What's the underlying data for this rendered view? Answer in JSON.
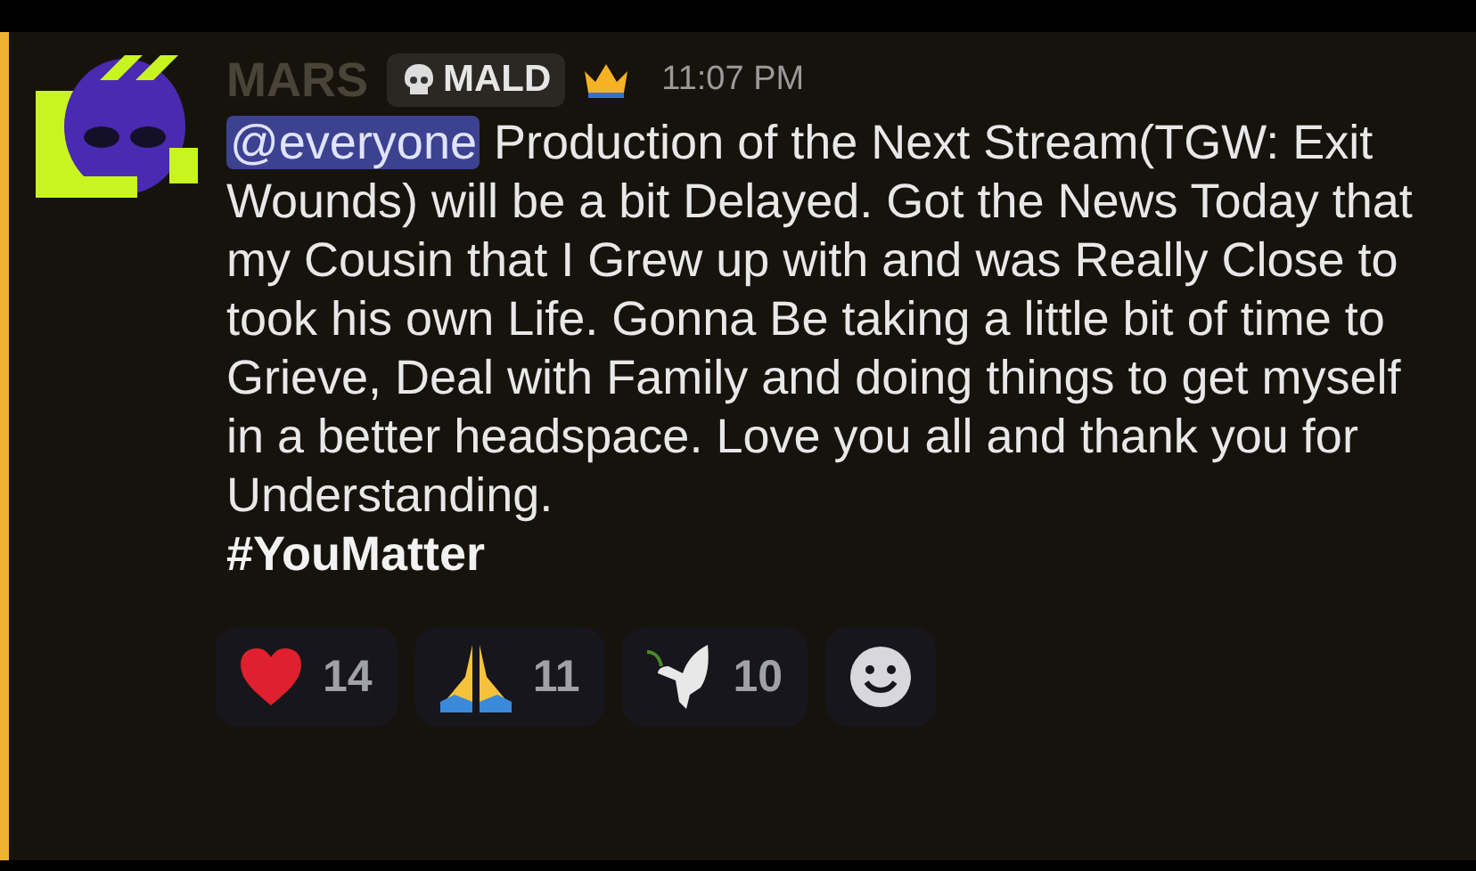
{
  "message": {
    "author": "MARS",
    "tag": "MALD",
    "timestamp": "11:07 PM",
    "mention": "@everyone",
    "text": "Production of the Next Stream(TGW: Exit Wounds) will be a bit Delayed. Got the News Today that my Cousin that I Grew up with and was Really Close to took his own Life. Gonna Be taking a little bit of time to Grieve, Deal with Family and doing things to get myself in a better headspace. Love you all and thank you for Understanding.",
    "hashtag": "#YouMatter"
  },
  "reactions": [
    {
      "kind": "heart",
      "count": "14"
    },
    {
      "kind": "pray",
      "count": "11"
    },
    {
      "kind": "dove",
      "count": "10"
    }
  ]
}
